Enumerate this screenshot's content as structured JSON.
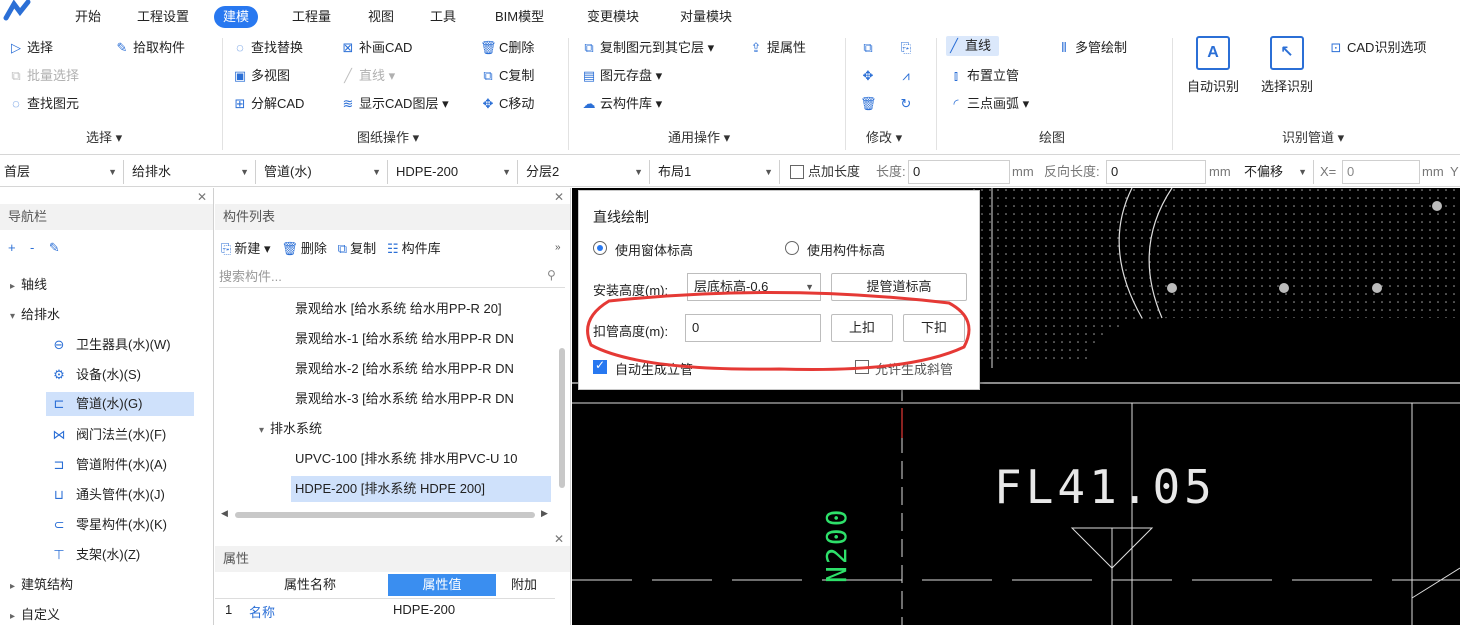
{
  "menu": {
    "tabs": [
      "开始",
      "工程设置",
      "建模",
      "工程量",
      "视图",
      "工具",
      "BIM模型",
      "变更模块",
      "对量模块"
    ],
    "active": 2
  },
  "ribbon": {
    "select": {
      "items": [
        "选择",
        "拾取构件",
        "批量选择",
        "查找图元"
      ],
      "label": "选择 ▾"
    },
    "drawing_ops": {
      "items": [
        "查找替换",
        "补画CAD",
        "C删除",
        "多视图",
        "直线",
        "C复制",
        "分解CAD",
        "显示CAD图层",
        "C移动"
      ],
      "label": "图纸操作 ▾"
    },
    "general_ops": {
      "items": [
        "复制图元到其它层",
        "提属性",
        "图元存盘",
        "云构件库"
      ],
      "label": "通用操作 ▾"
    },
    "modify": {
      "label": "修改 ▾"
    },
    "draw": {
      "items": [
        "直线",
        "多管绘制",
        "布置立管",
        "三点画弧"
      ],
      "label": "绘图"
    },
    "recognize": {
      "items": [
        "自动识别",
        "选择识别",
        "CAD识别选项"
      ],
      "label": "识别管道 ▾"
    }
  },
  "toolbar": {
    "floor": "首层",
    "system": "给排水",
    "type": "管道(水)",
    "component": "HDPE-200",
    "layer": "分层2",
    "layout": "布局1",
    "add_length_label": "点加长度",
    "length_label": "长度:",
    "length_value": "0",
    "mm1": "mm",
    "reverse_label": "反向长度:",
    "reverse_value": "0",
    "mm2": "mm",
    "offset": "不偏移",
    "x_label": "X=",
    "x_value": "0",
    "mm3": "mm",
    "y_label": "Y"
  },
  "nav": {
    "title": "导航栏",
    "tools": [
      "+",
      "-",
      "✎"
    ],
    "groups": [
      {
        "label": "轴线",
        "expanded": false
      },
      {
        "label": "给排水",
        "expanded": true
      },
      {
        "label": "建筑结构",
        "expanded": false
      },
      {
        "label": "自定义",
        "expanded": false
      }
    ],
    "items": [
      "卫生器具(水)(W)",
      "设备(水)(S)",
      "管道(水)(G)",
      "阀门法兰(水)(F)",
      "管道附件(水)(A)",
      "通头管件(水)(J)",
      "零星构件(水)(K)",
      "支架(水)(Z)"
    ],
    "selected": 2
  },
  "components": {
    "title": "构件列表",
    "new_label": "新建",
    "delete_label": "删除",
    "copy_label": "复制",
    "library_label": "构件库",
    "search_placeholder": "搜索构件...",
    "items": [
      "景观给水 [给水系统 给水用PP-R 20]",
      "景观给水-1 [给水系统 给水用PP-R DN",
      "景观给水-2 [给水系统 给水用PP-R DN",
      "景观给水-3 [给水系统 给水用PP-R DN"
    ],
    "drain_group": "排水系统",
    "drain_items": [
      "UPVC-100 [排水系统 排水用PVC-U 10",
      "HDPE-200 [排水系统 HDPE 200]"
    ],
    "selected_drain": 1
  },
  "properties": {
    "title": "属性",
    "col_name": "属性名称",
    "col_value": "属性值",
    "col_extra": "附加",
    "rows": [
      {
        "index": "1",
        "name": "名称",
        "value": "HDPE-200"
      }
    ]
  },
  "dialog": {
    "title": "直线绘制",
    "radio_window": "使用窗体标高",
    "radio_component": "使用构件标高",
    "install_height_label": "安装高度(m):",
    "install_height_value": "层底标高-0.6",
    "lift_button": "提管道标高",
    "buckle_label": "扣管高度(m):",
    "buckle_value": "0",
    "up_button": "上扣",
    "down_button": "下扣",
    "auto_riser": "自动生成立管",
    "allow_slope": "允许生成斜管"
  },
  "canvas": {
    "label_fl": "FL41.05",
    "label_green": "N200"
  },
  "colors": {
    "accent": "#2878f0",
    "icon": "#2b6fd6",
    "highlight_circle": "#e53935",
    "canvas_bg": "#000000"
  }
}
